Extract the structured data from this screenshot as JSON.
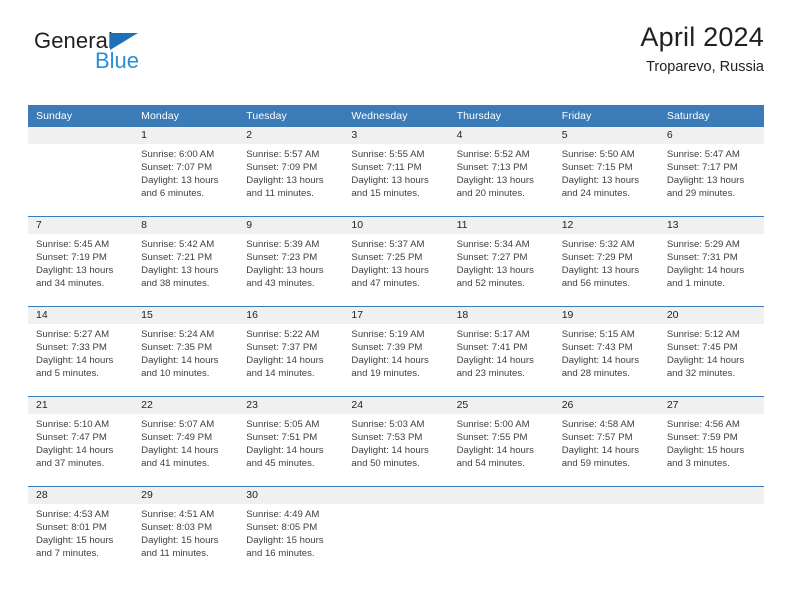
{
  "brand": {
    "name_top": "General",
    "name_bottom": "Blue",
    "triangle_icon": "blue-triangle-icon",
    "color_dark": "#231f20",
    "color_blue": "#2a8fd4",
    "color_triangle": "#1c70b8"
  },
  "header": {
    "title": "April 2024",
    "subtitle": "Troparevo, Russia"
  },
  "theme": {
    "header_blue": "#3b7cb8",
    "daynum_band": "#f0f0f0",
    "text": "#231f20",
    "body_text": "#3f3f3f"
  },
  "weekday_headers": [
    "Sunday",
    "Monday",
    "Tuesday",
    "Wednesday",
    "Thursday",
    "Friday",
    "Saturday"
  ],
  "weeks": [
    [
      {
        "day": "",
        "lines": []
      },
      {
        "day": "1",
        "lines": [
          "Sunrise: 6:00 AM",
          "Sunset: 7:07 PM",
          "Daylight: 13 hours",
          "and 6 minutes."
        ]
      },
      {
        "day": "2",
        "lines": [
          "Sunrise: 5:57 AM",
          "Sunset: 7:09 PM",
          "Daylight: 13 hours",
          "and 11 minutes."
        ]
      },
      {
        "day": "3",
        "lines": [
          "Sunrise: 5:55 AM",
          "Sunset: 7:11 PM",
          "Daylight: 13 hours",
          "and 15 minutes."
        ]
      },
      {
        "day": "4",
        "lines": [
          "Sunrise: 5:52 AM",
          "Sunset: 7:13 PM",
          "Daylight: 13 hours",
          "and 20 minutes."
        ]
      },
      {
        "day": "5",
        "lines": [
          "Sunrise: 5:50 AM",
          "Sunset: 7:15 PM",
          "Daylight: 13 hours",
          "and 24 minutes."
        ]
      },
      {
        "day": "6",
        "lines": [
          "Sunrise: 5:47 AM",
          "Sunset: 7:17 PM",
          "Daylight: 13 hours",
          "and 29 minutes."
        ]
      }
    ],
    [
      {
        "day": "7",
        "lines": [
          "Sunrise: 5:45 AM",
          "Sunset: 7:19 PM",
          "Daylight: 13 hours",
          "and 34 minutes."
        ]
      },
      {
        "day": "8",
        "lines": [
          "Sunrise: 5:42 AM",
          "Sunset: 7:21 PM",
          "Daylight: 13 hours",
          "and 38 minutes."
        ]
      },
      {
        "day": "9",
        "lines": [
          "Sunrise: 5:39 AM",
          "Sunset: 7:23 PM",
          "Daylight: 13 hours",
          "and 43 minutes."
        ]
      },
      {
        "day": "10",
        "lines": [
          "Sunrise: 5:37 AM",
          "Sunset: 7:25 PM",
          "Daylight: 13 hours",
          "and 47 minutes."
        ]
      },
      {
        "day": "11",
        "lines": [
          "Sunrise: 5:34 AM",
          "Sunset: 7:27 PM",
          "Daylight: 13 hours",
          "and 52 minutes."
        ]
      },
      {
        "day": "12",
        "lines": [
          "Sunrise: 5:32 AM",
          "Sunset: 7:29 PM",
          "Daylight: 13 hours",
          "and 56 minutes."
        ]
      },
      {
        "day": "13",
        "lines": [
          "Sunrise: 5:29 AM",
          "Sunset: 7:31 PM",
          "Daylight: 14 hours",
          "and 1 minute."
        ]
      }
    ],
    [
      {
        "day": "14",
        "lines": [
          "Sunrise: 5:27 AM",
          "Sunset: 7:33 PM",
          "Daylight: 14 hours",
          "and 5 minutes."
        ]
      },
      {
        "day": "15",
        "lines": [
          "Sunrise: 5:24 AM",
          "Sunset: 7:35 PM",
          "Daylight: 14 hours",
          "and 10 minutes."
        ]
      },
      {
        "day": "16",
        "lines": [
          "Sunrise: 5:22 AM",
          "Sunset: 7:37 PM",
          "Daylight: 14 hours",
          "and 14 minutes."
        ]
      },
      {
        "day": "17",
        "lines": [
          "Sunrise: 5:19 AM",
          "Sunset: 7:39 PM",
          "Daylight: 14 hours",
          "and 19 minutes."
        ]
      },
      {
        "day": "18",
        "lines": [
          "Sunrise: 5:17 AM",
          "Sunset: 7:41 PM",
          "Daylight: 14 hours",
          "and 23 minutes."
        ]
      },
      {
        "day": "19",
        "lines": [
          "Sunrise: 5:15 AM",
          "Sunset: 7:43 PM",
          "Daylight: 14 hours",
          "and 28 minutes."
        ]
      },
      {
        "day": "20",
        "lines": [
          "Sunrise: 5:12 AM",
          "Sunset: 7:45 PM",
          "Daylight: 14 hours",
          "and 32 minutes."
        ]
      }
    ],
    [
      {
        "day": "21",
        "lines": [
          "Sunrise: 5:10 AM",
          "Sunset: 7:47 PM",
          "Daylight: 14 hours",
          "and 37 minutes."
        ]
      },
      {
        "day": "22",
        "lines": [
          "Sunrise: 5:07 AM",
          "Sunset: 7:49 PM",
          "Daylight: 14 hours",
          "and 41 minutes."
        ]
      },
      {
        "day": "23",
        "lines": [
          "Sunrise: 5:05 AM",
          "Sunset: 7:51 PM",
          "Daylight: 14 hours",
          "and 45 minutes."
        ]
      },
      {
        "day": "24",
        "lines": [
          "Sunrise: 5:03 AM",
          "Sunset: 7:53 PM",
          "Daylight: 14 hours",
          "and 50 minutes."
        ]
      },
      {
        "day": "25",
        "lines": [
          "Sunrise: 5:00 AM",
          "Sunset: 7:55 PM",
          "Daylight: 14 hours",
          "and 54 minutes."
        ]
      },
      {
        "day": "26",
        "lines": [
          "Sunrise: 4:58 AM",
          "Sunset: 7:57 PM",
          "Daylight: 14 hours",
          "and 59 minutes."
        ]
      },
      {
        "day": "27",
        "lines": [
          "Sunrise: 4:56 AM",
          "Sunset: 7:59 PM",
          "Daylight: 15 hours",
          "and 3 minutes."
        ]
      }
    ],
    [
      {
        "day": "28",
        "lines": [
          "Sunrise: 4:53 AM",
          "Sunset: 8:01 PM",
          "Daylight: 15 hours",
          "and 7 minutes."
        ]
      },
      {
        "day": "29",
        "lines": [
          "Sunrise: 4:51 AM",
          "Sunset: 8:03 PM",
          "Daylight: 15 hours",
          "and 11 minutes."
        ]
      },
      {
        "day": "30",
        "lines": [
          "Sunrise: 4:49 AM",
          "Sunset: 8:05 PM",
          "Daylight: 15 hours",
          "and 16 minutes."
        ]
      },
      {
        "day": "",
        "lines": []
      },
      {
        "day": "",
        "lines": []
      },
      {
        "day": "",
        "lines": []
      },
      {
        "day": "",
        "lines": []
      }
    ]
  ]
}
